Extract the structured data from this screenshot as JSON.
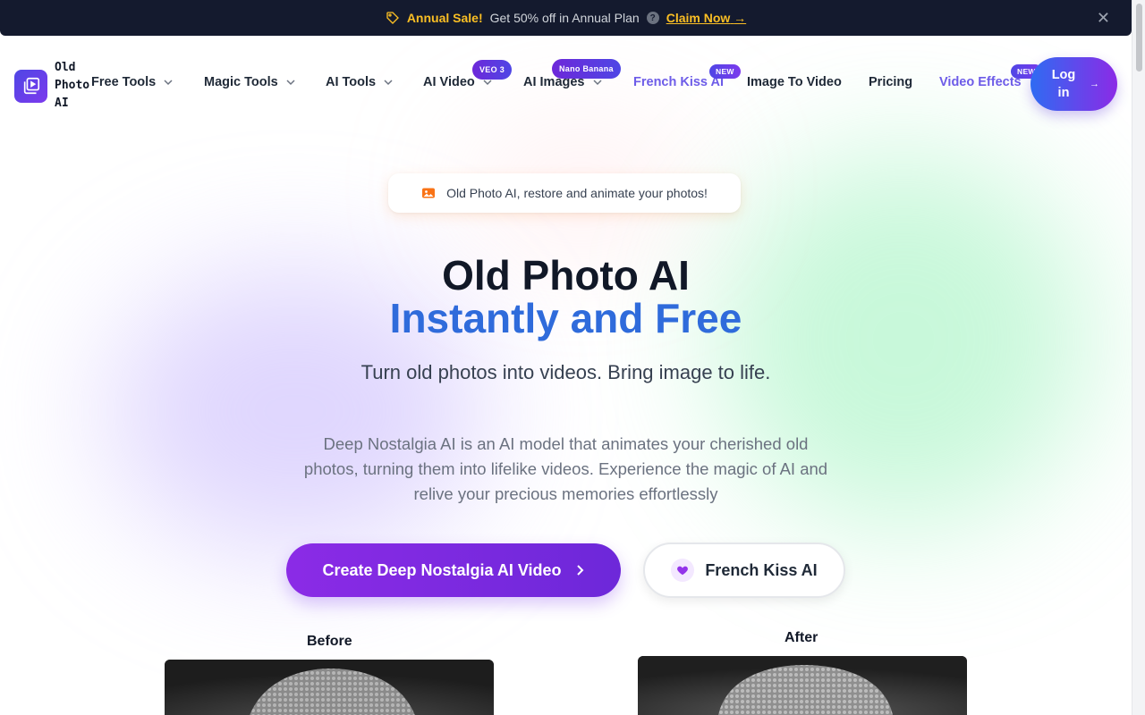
{
  "announcement": {
    "sale_label": "Annual Sale!",
    "offer_text": "Get 50% off in Annual Plan",
    "help_glyph": "?",
    "claim_label": "Claim Now",
    "claim_arrow": "→",
    "close_glyph": "✕"
  },
  "nav": {
    "logo_text": "Old Photo AI",
    "items": [
      {
        "label": "Free Tools",
        "dropdown": true
      },
      {
        "label": "Magic Tools",
        "dropdown": true
      },
      {
        "label": "AI Tools",
        "dropdown": true
      },
      {
        "label": "AI Video",
        "dropdown": true,
        "badge": "VEO 3"
      },
      {
        "label": "AI Images",
        "dropdown": true,
        "badge": "Nano Banana"
      },
      {
        "label": "French Kiss AI",
        "dropdown": false,
        "badge": "NEW"
      },
      {
        "label": "Image To Video",
        "dropdown": false
      },
      {
        "label": "Pricing",
        "dropdown": false
      },
      {
        "label": "Video Effects",
        "dropdown": false,
        "badge": "NEW"
      }
    ],
    "login_label": "Log in",
    "login_arrow": "→"
  },
  "hero": {
    "pill_text": "Old Photo AI, restore and animate your photos!",
    "title_line1": "Old Photo AI",
    "title_line2": "Instantly and Free",
    "subtitle": "Turn old photos into videos. Bring image to life.",
    "description": "Deep Nostalgia AI is an AI model that animates your cherished old photos, turning them into lifelike videos. Experience the magic of AI and relive your precious memories effortlessly",
    "cta_primary": "Create Deep Nostalgia AI Video",
    "cta_secondary": "French Kiss AI"
  },
  "comparison": {
    "before_label": "Before",
    "after_label": "After"
  },
  "colors": {
    "topbar_bg": "#141a2e",
    "sale_accent": "#fbbf24",
    "title_blue": "#2f6bdb",
    "brand_purple": "#7c3aed",
    "nav_accent": "#6d5ce8"
  }
}
